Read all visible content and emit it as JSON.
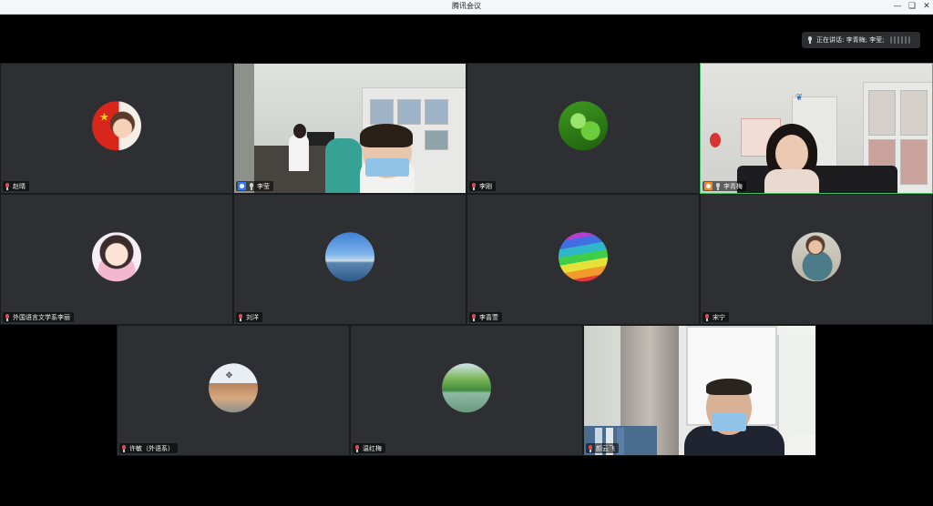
{
  "window": {
    "title": "腾讯会议",
    "controls": [
      "minimize-icon",
      "restore-icon",
      "close-icon"
    ]
  },
  "speaking": {
    "label": "正在讲话: 李青梅; 李莹;"
  },
  "participants": [
    {
      "name": "赵晴",
      "type": "avatar",
      "avatar": "china-flag-girl-avatar"
    },
    {
      "name": "李莹",
      "type": "video",
      "host_badge": "blue"
    },
    {
      "name": "李刚",
      "type": "avatar",
      "avatar": "green-grass-avatar"
    },
    {
      "name": "李青梅",
      "type": "video",
      "host_badge": "orange",
      "active": true
    },
    {
      "name": "外国语言文学系李丽",
      "type": "avatar",
      "avatar": "cartoon-girl-avatar"
    },
    {
      "name": "刘洋",
      "type": "avatar",
      "avatar": "harbor-sky-avatar"
    },
    {
      "name": "李喜萱",
      "type": "avatar",
      "avatar": "rainbow-droplets-avatar"
    },
    {
      "name": "宋宁",
      "type": "avatar",
      "avatar": "woman-flowers-avatar"
    },
    {
      "name": "许敏（外语系）",
      "type": "avatar",
      "avatar": "building-birds-avatar"
    },
    {
      "name": "温红梅",
      "type": "avatar",
      "avatar": "park-lake-avatar"
    },
    {
      "name": "颜云飞",
      "type": "video"
    }
  ],
  "colors": {
    "tile_bg": "#2e2f33",
    "active_border": "#3ec16b",
    "host_blue": "#2f7cf6",
    "host_orange": "#f08a24"
  }
}
